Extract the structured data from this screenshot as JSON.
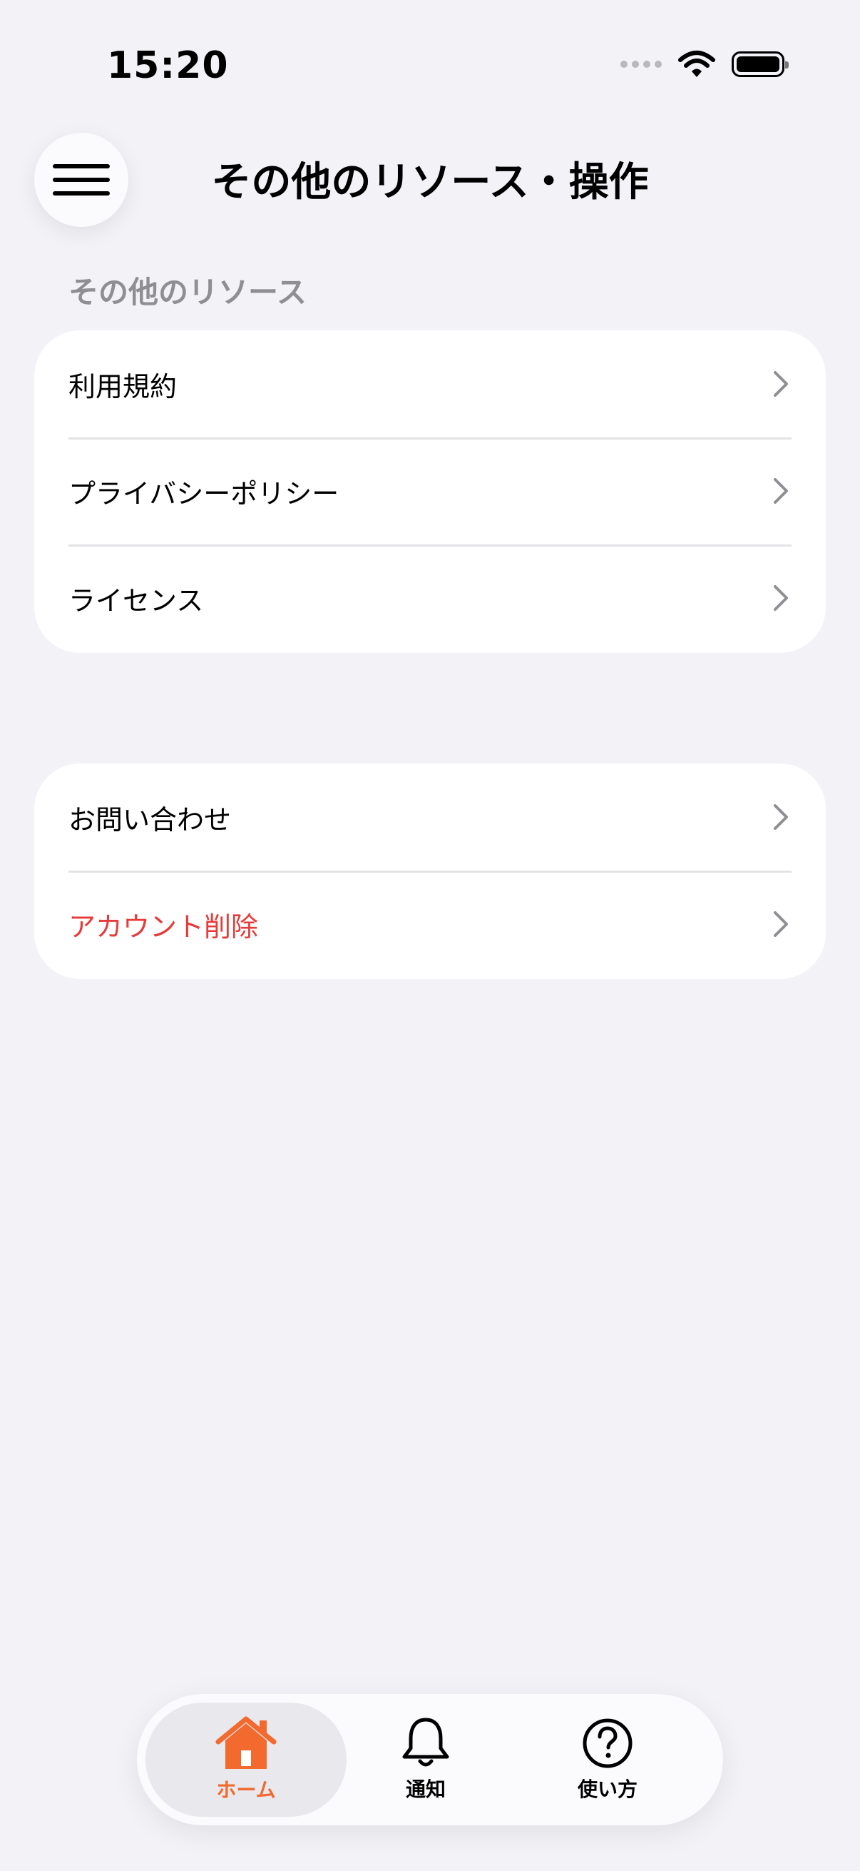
{
  "status_bar": {
    "time": "15:20"
  },
  "header": {
    "title": "その他のリソース・操作",
    "menu_icon": "hamburger-menu-icon"
  },
  "sections": {
    "resources": {
      "header": "その他のリソース",
      "items": [
        {
          "label": "利用規約"
        },
        {
          "label": "プライバシーポリシー"
        },
        {
          "label": "ライセンス"
        }
      ]
    },
    "actions": {
      "items": [
        {
          "label": "お問い合わせ"
        },
        {
          "label": "アカウント削除",
          "style": "danger"
        }
      ]
    }
  },
  "tab_bar": {
    "tabs": [
      {
        "label": "ホーム",
        "icon": "home-icon",
        "active": true
      },
      {
        "label": "通知",
        "icon": "bell-icon",
        "active": false
      },
      {
        "label": "使い方",
        "icon": "help-circle-icon",
        "active": false
      }
    ]
  },
  "colors": {
    "background": "#f2f2f7",
    "accent": "#f26a2e",
    "danger": "#e63b3b",
    "secondary_text": "#8e8e93",
    "chevron": "#8e8e93"
  }
}
